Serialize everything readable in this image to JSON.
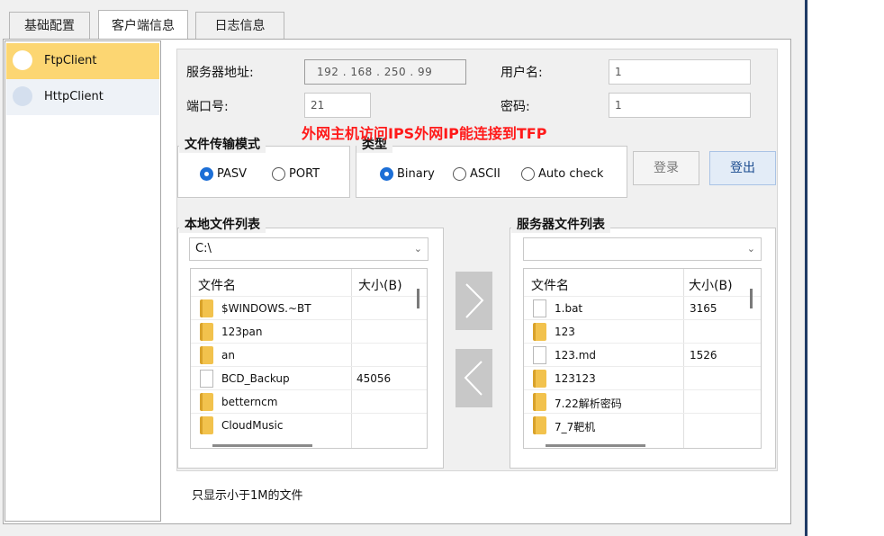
{
  "tabs": [
    {
      "label": "基础配置",
      "active": false
    },
    {
      "label": "客户端信息",
      "active": true
    },
    {
      "label": "日志信息",
      "active": false
    }
  ],
  "clients": [
    {
      "label": "FtpClient",
      "selected": true
    },
    {
      "label": "HttpClient",
      "selected": false
    }
  ],
  "server": {
    "address_label": "服务器地址:",
    "address_value": "192 . 168 . 250 . 99",
    "username_label": "用户名:",
    "username_value": "1",
    "port_label": "端口号:",
    "port_value": "21",
    "password_label": "密码:",
    "password_value": "1"
  },
  "annotation": "外网主机访问IPS外网IP能连接到TFP",
  "transfer_mode": {
    "title": "文件传输模式",
    "options": [
      {
        "label": "PASV",
        "checked": true
      },
      {
        "label": "PORT",
        "checked": false
      }
    ]
  },
  "type_group": {
    "title": "类型",
    "options": [
      {
        "label": "Binary",
        "checked": true
      },
      {
        "label": "ASCII",
        "checked": false
      },
      {
        "label": "Auto check",
        "checked": false
      }
    ]
  },
  "buttons": {
    "login": "登录",
    "logout": "登出"
  },
  "local": {
    "title": "本地文件列表",
    "path": "C:\\",
    "columns": [
      "文件名",
      "大小(B)"
    ],
    "rows": [
      {
        "icon": "folder-icon",
        "name": "$WINDOWS.~BT",
        "size": ""
      },
      {
        "icon": "folder-icon",
        "name": "123pan",
        "size": ""
      },
      {
        "icon": "folder-icon",
        "name": "an",
        "size": ""
      },
      {
        "icon": "file-icon",
        "name": "BCD_Backup",
        "size": "45056"
      },
      {
        "icon": "folder-icon",
        "name": "betterncm",
        "size": ""
      },
      {
        "icon": "folder-icon",
        "name": "CloudMusic",
        "size": ""
      }
    ]
  },
  "remote": {
    "title": "服务器文件列表",
    "path": "",
    "columns": [
      "文件名",
      "大小(B)"
    ],
    "rows": [
      {
        "icon": "file-icon",
        "name": "1.bat",
        "size": "3165"
      },
      {
        "icon": "folder-icon",
        "name": "123",
        "size": ""
      },
      {
        "icon": "file-icon",
        "name": "123.md",
        "size": "1526"
      },
      {
        "icon": "folder-icon",
        "name": "123123",
        "size": ""
      },
      {
        "icon": "folder-icon",
        "name": "7.22解析密码",
        "size": ""
      },
      {
        "icon": "folder-icon",
        "name": "7_7靶机",
        "size": ""
      }
    ]
  },
  "footnote": "只显示小于1M的文件",
  "colors": {
    "selected_item": "#fcd672",
    "radio_checked": "#1d6fd6",
    "annotation": "#ff1a1a",
    "window_edge": "#1f3b66"
  }
}
